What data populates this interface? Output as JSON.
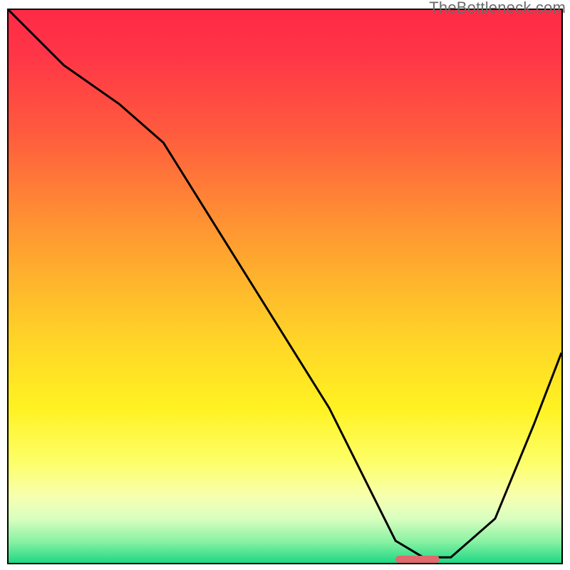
{
  "watermark": "TheBottleneck.com",
  "chart_data": {
    "type": "line",
    "title": "",
    "xlabel": "",
    "ylabel": "",
    "xlim": [
      0,
      100
    ],
    "ylim": [
      0,
      100
    ],
    "grid": false,
    "note": "Axes are unlabeled; values are normalized 0–100 from visual estimation.",
    "series": [
      {
        "name": "bottleneck-curve",
        "x": [
          0,
          10,
          20,
          28,
          38,
          48,
          58,
          65,
          70,
          75,
          80,
          88,
          95,
          100
        ],
        "y": [
          100,
          90,
          83,
          76,
          60,
          44,
          28,
          14,
          4,
          1,
          1,
          8,
          25,
          38
        ]
      }
    ],
    "optimal_zone": {
      "x_start": 70,
      "x_end": 78,
      "label": ""
    }
  },
  "colors": {
    "curve": "#000000",
    "marker": "#e06a6d",
    "gradient_top": "#ff2a46",
    "gradient_bottom": "#1fd884"
  }
}
